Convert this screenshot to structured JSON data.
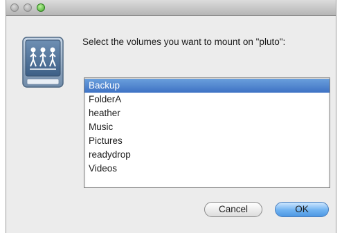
{
  "dialog": {
    "prompt": "Select the volumes you want to mount on \"pluto\":",
    "volumes": [
      "Backup",
      "FolderA",
      "heather",
      "Music",
      "Pictures",
      "readydrop",
      "Videos"
    ],
    "selected_volume": "Backup",
    "cancel_label": "Cancel",
    "ok_label": "OK"
  },
  "icons": {
    "server": "network-server-icon",
    "close": "close-icon",
    "minimize": "minimize-icon",
    "zoom": "zoom-icon"
  },
  "colors": {
    "selection": "#3e72c4",
    "default_button": "#6fb2f1",
    "zoom_button": "#3fa82a"
  }
}
